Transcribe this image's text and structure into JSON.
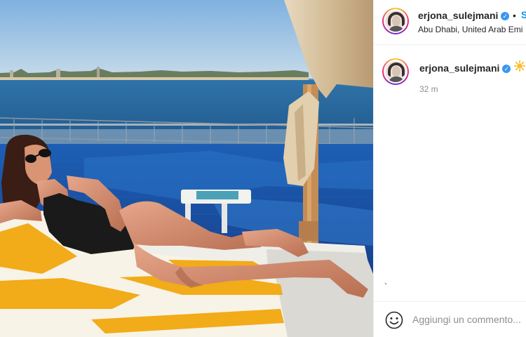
{
  "post": {
    "username": "erjona_sulejmani",
    "verified_glyph": "✓",
    "separator": "•",
    "follow_label": "S",
    "location": "Abu Dhabi, United Arab Emi"
  },
  "caption": {
    "username": "erjona_sulejmani",
    "verified_glyph": "✓",
    "emoji": "sun-emoji",
    "timestamp": "32 m",
    "stray_char": "`"
  },
  "comment": {
    "placeholder": "Aggiungi un commento..."
  },
  "icons": {
    "emoji_button": "smiley-face-icon"
  },
  "colors": {
    "link_blue": "#0095f6",
    "verified_blue": "#3897f0",
    "text": "#262626",
    "secondary": "#8e8e8e"
  }
}
